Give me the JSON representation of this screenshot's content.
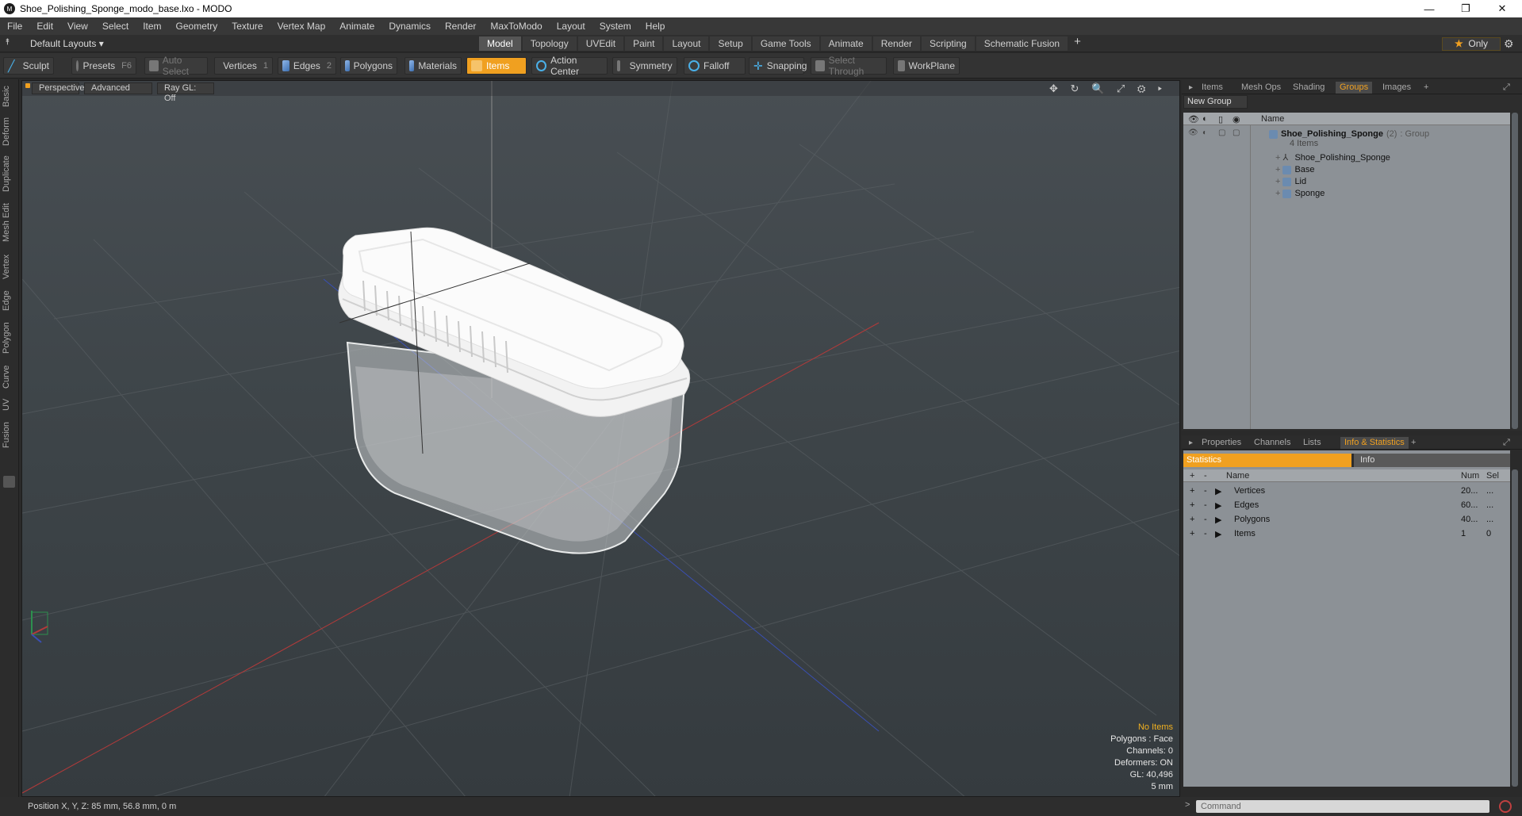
{
  "window": {
    "title": "Shoe_Polishing_Sponge_modo_base.lxo - MODO",
    "app_icon": "modo-logo-icon"
  },
  "window_controls": {
    "minimize": "—",
    "maximize": "❐",
    "close": "✕"
  },
  "menu": [
    "File",
    "Edit",
    "View",
    "Select",
    "Item",
    "Geometry",
    "Texture",
    "Vertex Map",
    "Animate",
    "Dynamics",
    "Render",
    "MaxToModo",
    "Layout",
    "System",
    "Help"
  ],
  "layout": {
    "default_label": "Default Layouts ▾",
    "tabs": [
      "Model",
      "Topology",
      "UVEdit",
      "Paint",
      "Layout",
      "Setup",
      "Game Tools",
      "Animate",
      "Render",
      "Scripting",
      "Schematic Fusion"
    ],
    "active_tab": "Model",
    "add_tab": "+",
    "only_label": "Only",
    "only_star": "★"
  },
  "toolbar": {
    "sculpt": "Sculpt",
    "presets": "Presets",
    "presets_key": "F6",
    "auto_select": "Auto Select",
    "vertices": "Vertices",
    "vertices_count": "1",
    "edges": "Edges",
    "edges_count": "2",
    "polygons": "Polygons",
    "materials": "Materials",
    "items": "Items",
    "action_center": "Action Center",
    "symmetry": "Symmetry",
    "falloff": "Falloff",
    "snapping": "Snapping",
    "select_through": "Select Through",
    "workplane": "WorkPlane"
  },
  "left_tabs": [
    "Basic",
    "Deform",
    "Duplicate",
    "Mesh Edit",
    "Vertex",
    "Edge",
    "Polygon",
    "Curve",
    "UV",
    "Fusion"
  ],
  "viewport": {
    "view_label": "Perspective",
    "advanced_label": "Advanced",
    "raygl_label": "Ray GL: Off",
    "icons": "✥ ↻ 🔍 ⤢ ⚙ ▸",
    "info": {
      "no_items": "No Items",
      "polygons": "Polygons : Face",
      "channels": "Channels: 0",
      "deformers": "Deformers: ON",
      "gl": "GL: 40,496",
      "scale": "5 mm"
    }
  },
  "status": {
    "position": "Position X, Y, Z:  85 mm, 56.8 mm, 0 m"
  },
  "right_top": {
    "tabs": [
      "Items",
      "Mesh Ops",
      "Shading",
      "Groups",
      "Images"
    ],
    "active_tab": "Groups",
    "add": "+",
    "new_group": "New Group",
    "column_name": "Name",
    "group": {
      "name": "Shoe_Polishing_Sponge",
      "count": "(2)",
      "type": ": Group",
      "items_label": "4 Items"
    },
    "children": [
      {
        "name": "Shoe_Polishing_Sponge",
        "icon": "locator-icon"
      },
      {
        "name": "Base",
        "icon": "mesh-icon"
      },
      {
        "name": "Lid",
        "icon": "mesh-icon"
      },
      {
        "name": "Sponge",
        "icon": "mesh-icon"
      }
    ]
  },
  "right_bottom": {
    "tabs": [
      "Properties",
      "Channels",
      "Lists",
      "Info & Statistics"
    ],
    "active_tab": "Info & Statistics",
    "add": "+",
    "statistics_label": "Statistics",
    "info_label": "Info",
    "columns": {
      "name": "Name",
      "num": "Num",
      "sel": "Sel"
    },
    "rows": [
      {
        "name": "Vertices",
        "num": "20...",
        "sel": "..."
      },
      {
        "name": "Edges",
        "num": "60...",
        "sel": "..."
      },
      {
        "name": "Polygons",
        "num": "40...",
        "sel": "..."
      },
      {
        "name": "Items",
        "num": "1",
        "sel": "0"
      }
    ]
  },
  "command": {
    "placeholder": "Command",
    "prompt": ">"
  },
  "colors": {
    "accent": "#f0a020",
    "viewport_bg": "#3e4549",
    "panel_bg": "#8c9196"
  }
}
